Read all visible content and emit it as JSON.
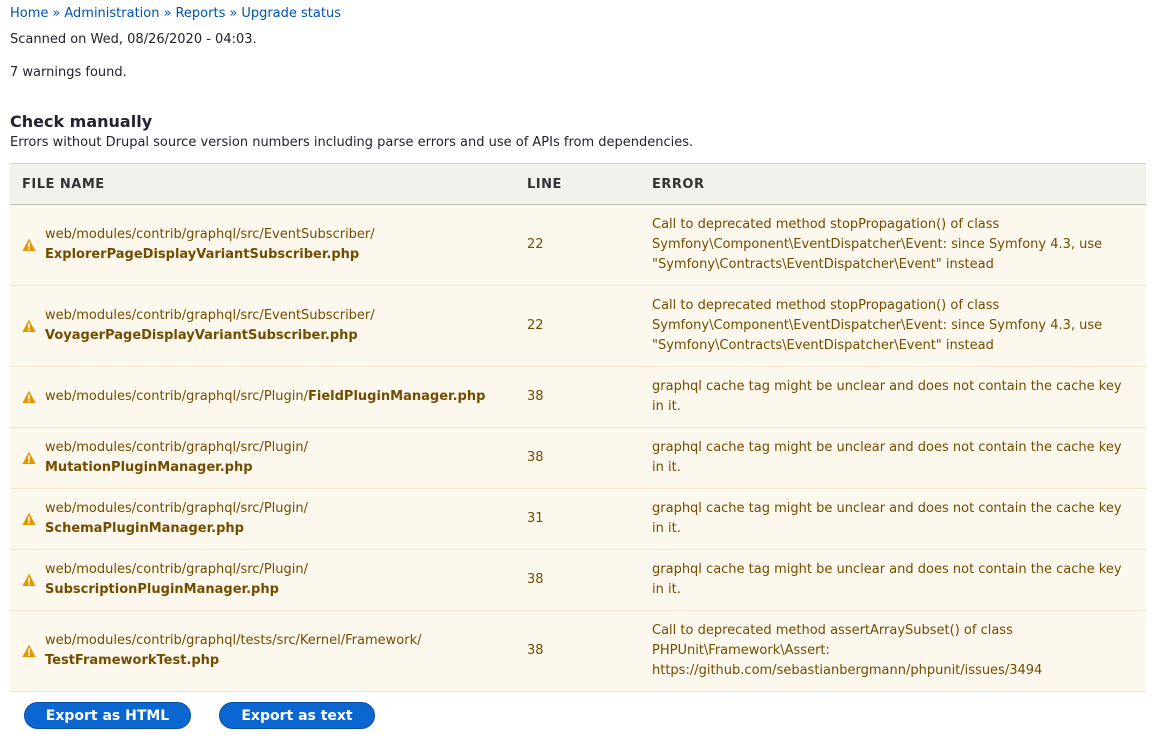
{
  "breadcrumb": {
    "items": [
      "Home",
      "Administration",
      "Reports",
      "Upgrade status"
    ],
    "separator": "»"
  },
  "scan": {
    "scanned_text": "Scanned on Wed, 08/26/2020 - 04:03.",
    "warnings_text": "7 warnings found."
  },
  "section": {
    "title": "Check manually",
    "description": "Errors without Drupal source version numbers including parse errors and use of APIs from dependencies."
  },
  "table": {
    "headers": [
      "FILE NAME",
      "LINE",
      "ERROR"
    ],
    "rows": [
      {
        "path": "web/modules/contrib/graphql/src/EventSubscriber/",
        "file": "ExplorerPageDisplayVariantSubscriber.php",
        "line": "22",
        "error": "Call to deprecated method stopPropagation() of class Symfony\\Component\\EventDispatcher\\Event: since Symfony 4.3, use \"Symfony\\Contracts\\EventDispatcher\\Event\" instead"
      },
      {
        "path": "web/modules/contrib/graphql/src/EventSubscriber/",
        "file": "VoyagerPageDisplayVariantSubscriber.php",
        "line": "22",
        "error": "Call to deprecated method stopPropagation() of class Symfony\\Component\\EventDispatcher\\Event: since Symfony 4.3, use \"Symfony\\Contracts\\EventDispatcher\\Event\" instead"
      },
      {
        "path": "web/modules/contrib/graphql/src/Plugin/",
        "file": "FieldPluginManager.php",
        "line": "38",
        "error": "graphql cache tag might be unclear and does not contain the cache key in it."
      },
      {
        "path": "web/modules/contrib/graphql/src/Plugin/",
        "file": "MutationPluginManager.php",
        "line": "38",
        "error": "graphql cache tag might be unclear and does not contain the cache key in it."
      },
      {
        "path": "web/modules/contrib/graphql/src/Plugin/",
        "file": "SchemaPluginManager.php",
        "line": "31",
        "error": "graphql cache tag might be unclear and does not contain the cache key in it."
      },
      {
        "path": "web/modules/contrib/graphql/src/Plugin/",
        "file": "SubscriptionPluginManager.php",
        "line": "38",
        "error": "graphql cache tag might be unclear and does not contain the cache key in it."
      },
      {
        "path": "web/modules/contrib/graphql/tests/src/Kernel/Framework/",
        "file": "TestFrameworkTest.php",
        "line": "38",
        "error": "Call to deprecated method assertArraySubset() of class PHPUnit\\Framework\\Assert: https://github.com/sebastianbergmann/phpunit/issues/3494"
      }
    ]
  },
  "actions": {
    "export_html": "Export as HTML",
    "export_text": "Export as text"
  },
  "icons": {
    "row_status": "warning-icon"
  },
  "colors": {
    "link": "#0053ad",
    "warning_text": "#734c00",
    "warning_bg": "#fdf8ed",
    "warning_icon": "#e29700",
    "button": "#0a66d1"
  }
}
